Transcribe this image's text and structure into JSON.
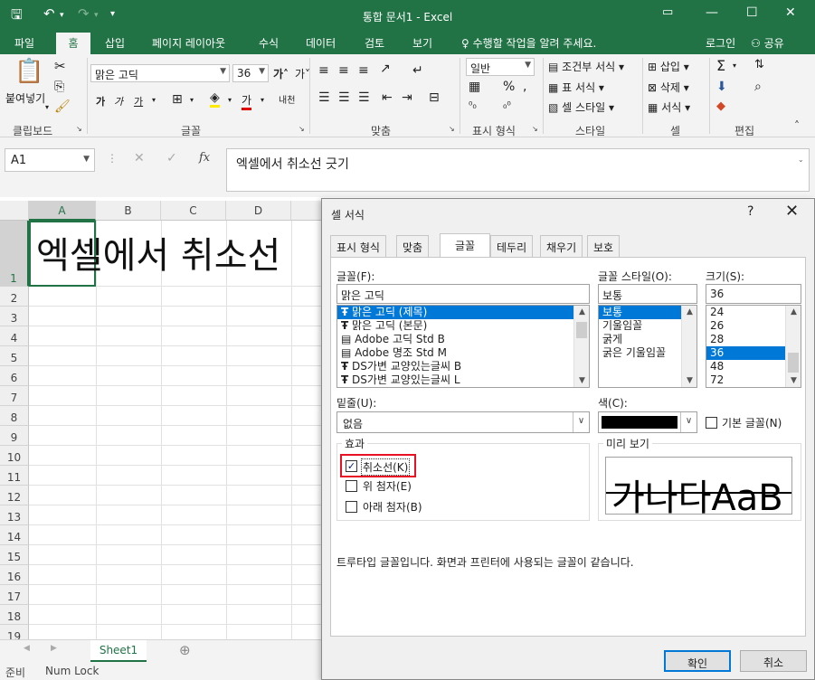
{
  "titlebar": {
    "title": "통합 문서1 - Excel",
    "minimize_icon": "minimize-icon",
    "maximize_icon": "maximize-icon",
    "close_icon": "close-icon"
  },
  "menu": {
    "tabs": [
      "파일",
      "홈",
      "삽입",
      "페이지 레이아웃",
      "수식",
      "데이터",
      "검토",
      "보기"
    ],
    "tellme": "수행할 작업을 알려 주세요.",
    "login": "로그인",
    "share": "공유"
  },
  "ribbon": {
    "paste": "붙여넣기",
    "font_name": "맑은 고딕",
    "font_size": "36",
    "number_format": "일반",
    "conditional_format": "조건부 서식",
    "table_format": "표 서식",
    "cell_style": "셀 스타일",
    "insert": "삽입",
    "delete": "삭제",
    "format": "서식",
    "groups": [
      "클립보드",
      "글꼴",
      "맞춤",
      "표시 형식",
      "스타일",
      "셀",
      "편집"
    ]
  },
  "formula_bar": {
    "name_box": "A1",
    "fx_label": "fx",
    "content": "엑셀에서 취소선 긋기"
  },
  "sheet": {
    "columns": [
      "A",
      "B",
      "C",
      "D"
    ],
    "rows": [
      "1",
      "2",
      "3",
      "4",
      "5",
      "6",
      "7",
      "8",
      "9",
      "10",
      "11",
      "12",
      "13",
      "14",
      "15",
      "16",
      "17",
      "18",
      "19"
    ],
    "cell_a1_display": "엑셀에서 취소선",
    "sheet_tab": "Sheet1",
    "status_ready": "준비",
    "status_numlock": "Num Lock"
  },
  "dialog": {
    "title": "셀 서식",
    "help": "?",
    "tabs": [
      "표시 형식",
      "맞춤",
      "글꼴",
      "테두리",
      "채우기",
      "보호"
    ],
    "font_label": "글꼴(F):",
    "font_value": "맑은 고딕",
    "font_list": [
      "맑은 고딕 (제목)",
      "맑은 고딕 (본문)",
      "Adobe 고딕 Std B",
      "Adobe 명조 Std M",
      "DS가변 교양있는글씨 B",
      "DS가변 교양있는글씨 L"
    ],
    "style_label": "글꼴 스타일(O):",
    "style_value": "보통",
    "style_list": [
      "보통",
      "기울임꼴",
      "굵게",
      "굵은 기울임꼴"
    ],
    "size_label": "크기(S):",
    "size_value": "36",
    "size_list": [
      "24",
      "26",
      "28",
      "36",
      "48",
      "72"
    ],
    "underline_label": "밑줄(U):",
    "underline_value": "없음",
    "color_label": "색(C):",
    "color_value": "#000000",
    "normal_font_label": "기본 글꼴(N)",
    "effects_label": "효과",
    "strike_label": "취소선(K)",
    "super_label": "위 첨자(E)",
    "sub_label": "아래 첨자(B)",
    "strike_checked": true,
    "preview_label": "미리 보기",
    "preview_text": "가나다AaB",
    "info": "트루타입 글꼴입니다. 화면과 프린터에 사용되는 글꼴이 같습니다.",
    "ok": "확인",
    "cancel": "취소",
    "highlight_color": "#e81123"
  },
  "colors": {
    "excel_green": "#217346",
    "selection_blue": "#0078d7"
  }
}
